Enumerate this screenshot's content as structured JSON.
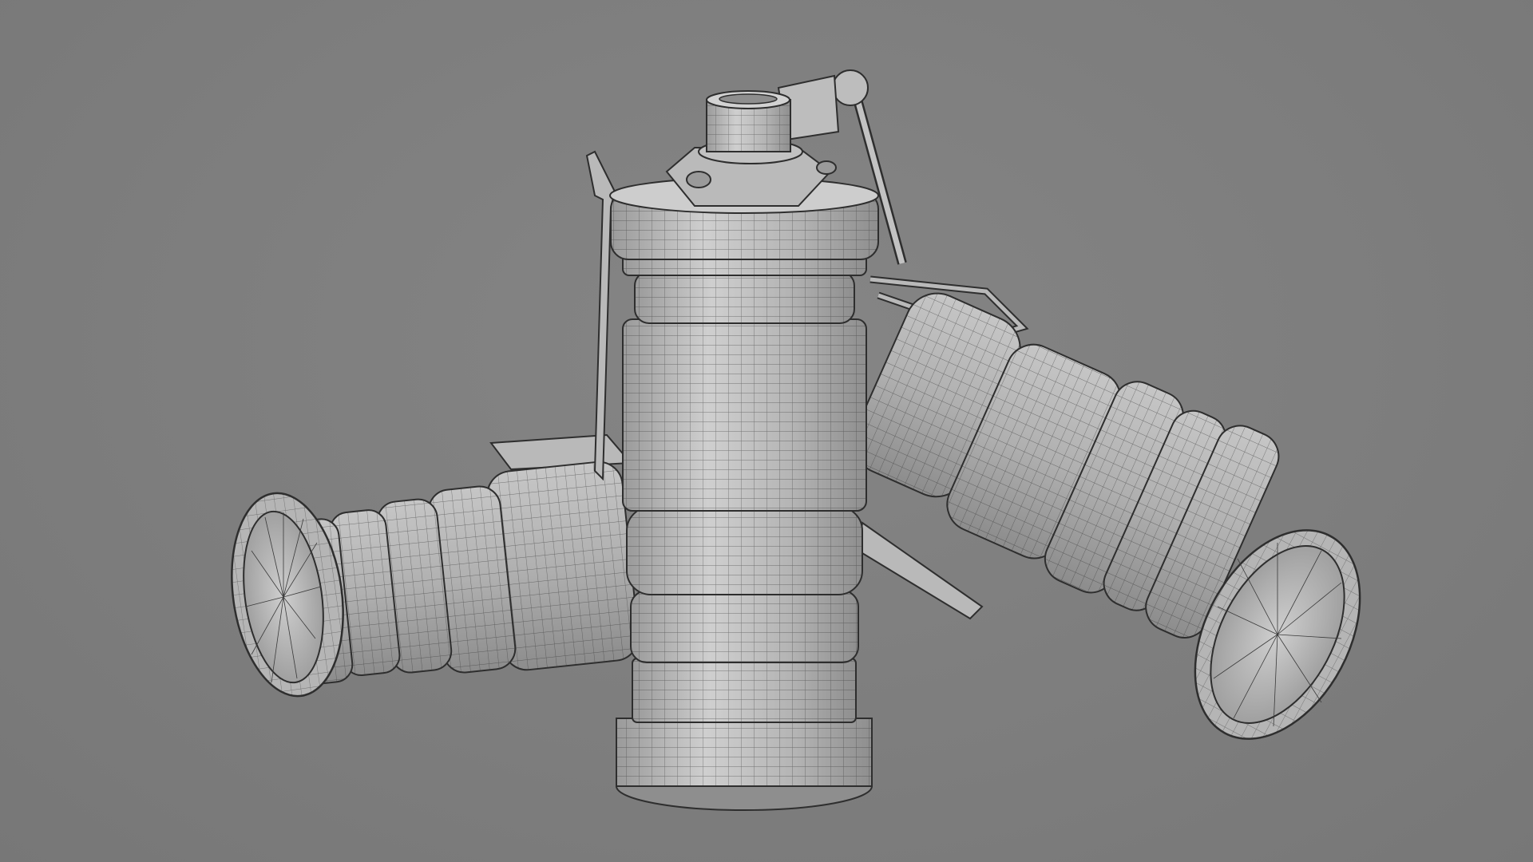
{
  "viewport": {
    "background_color": "#7e7e7e",
    "view_mode": "wireframe-on-shaded"
  },
  "scene": {
    "subject": "three-grenade-models",
    "objects": [
      {
        "name": "grenade-left-lying",
        "role": "lying"
      },
      {
        "name": "grenade-center-standing",
        "role": "standing"
      },
      {
        "name": "grenade-right-lying",
        "role": "lying"
      }
    ]
  },
  "colors": {
    "shaded_light": "#c9c9c9",
    "shaded_mid": "#a9a9a9",
    "shaded_dark": "#8a8a8a",
    "wire": "#2e2e2e",
    "interior": "#bdbdbd"
  }
}
